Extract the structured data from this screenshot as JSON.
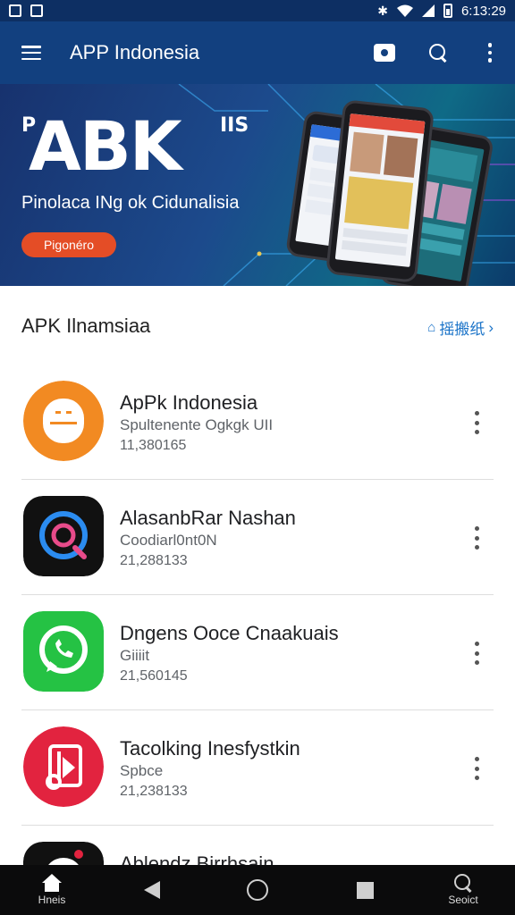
{
  "status_bar": {
    "time": "6:13:29"
  },
  "app_bar": {
    "title": "APP Indonesia"
  },
  "banner": {
    "headline_prefix": "P",
    "headline": "ABK",
    "headline_suffix": "IIS",
    "subtitle": "Pinolaca INg ok Cidunalisia",
    "button_label": "Pigonéro"
  },
  "section": {
    "title": "APK Ilnamsiaa",
    "see_all_label": "摇搬纸"
  },
  "apps": [
    {
      "name": "ApPk Indonesia",
      "category": "Spultenente Ogkgk UII",
      "meta": "11,380165"
    },
    {
      "name": "AlasanbRar Nashan",
      "category": "Coodiarl0nt0N",
      "meta": "21,288133"
    },
    {
      "name": "Dngens Ooce Cnaakuais",
      "category": "Giiiit",
      "meta": "21,560145"
    },
    {
      "name": "Tacolking Inesfystkin",
      "category": "Spbce",
      "meta": "21,238133"
    },
    {
      "name": "Ablendz Birrhsain",
      "category": "",
      "meta": ""
    }
  ],
  "nav_bar": {
    "home_label": "Hneis",
    "search_label": "Seoict"
  },
  "colors": {
    "app_bar": "#12407f",
    "accent": "#1a73c8",
    "banner_button": "#e44d26"
  }
}
